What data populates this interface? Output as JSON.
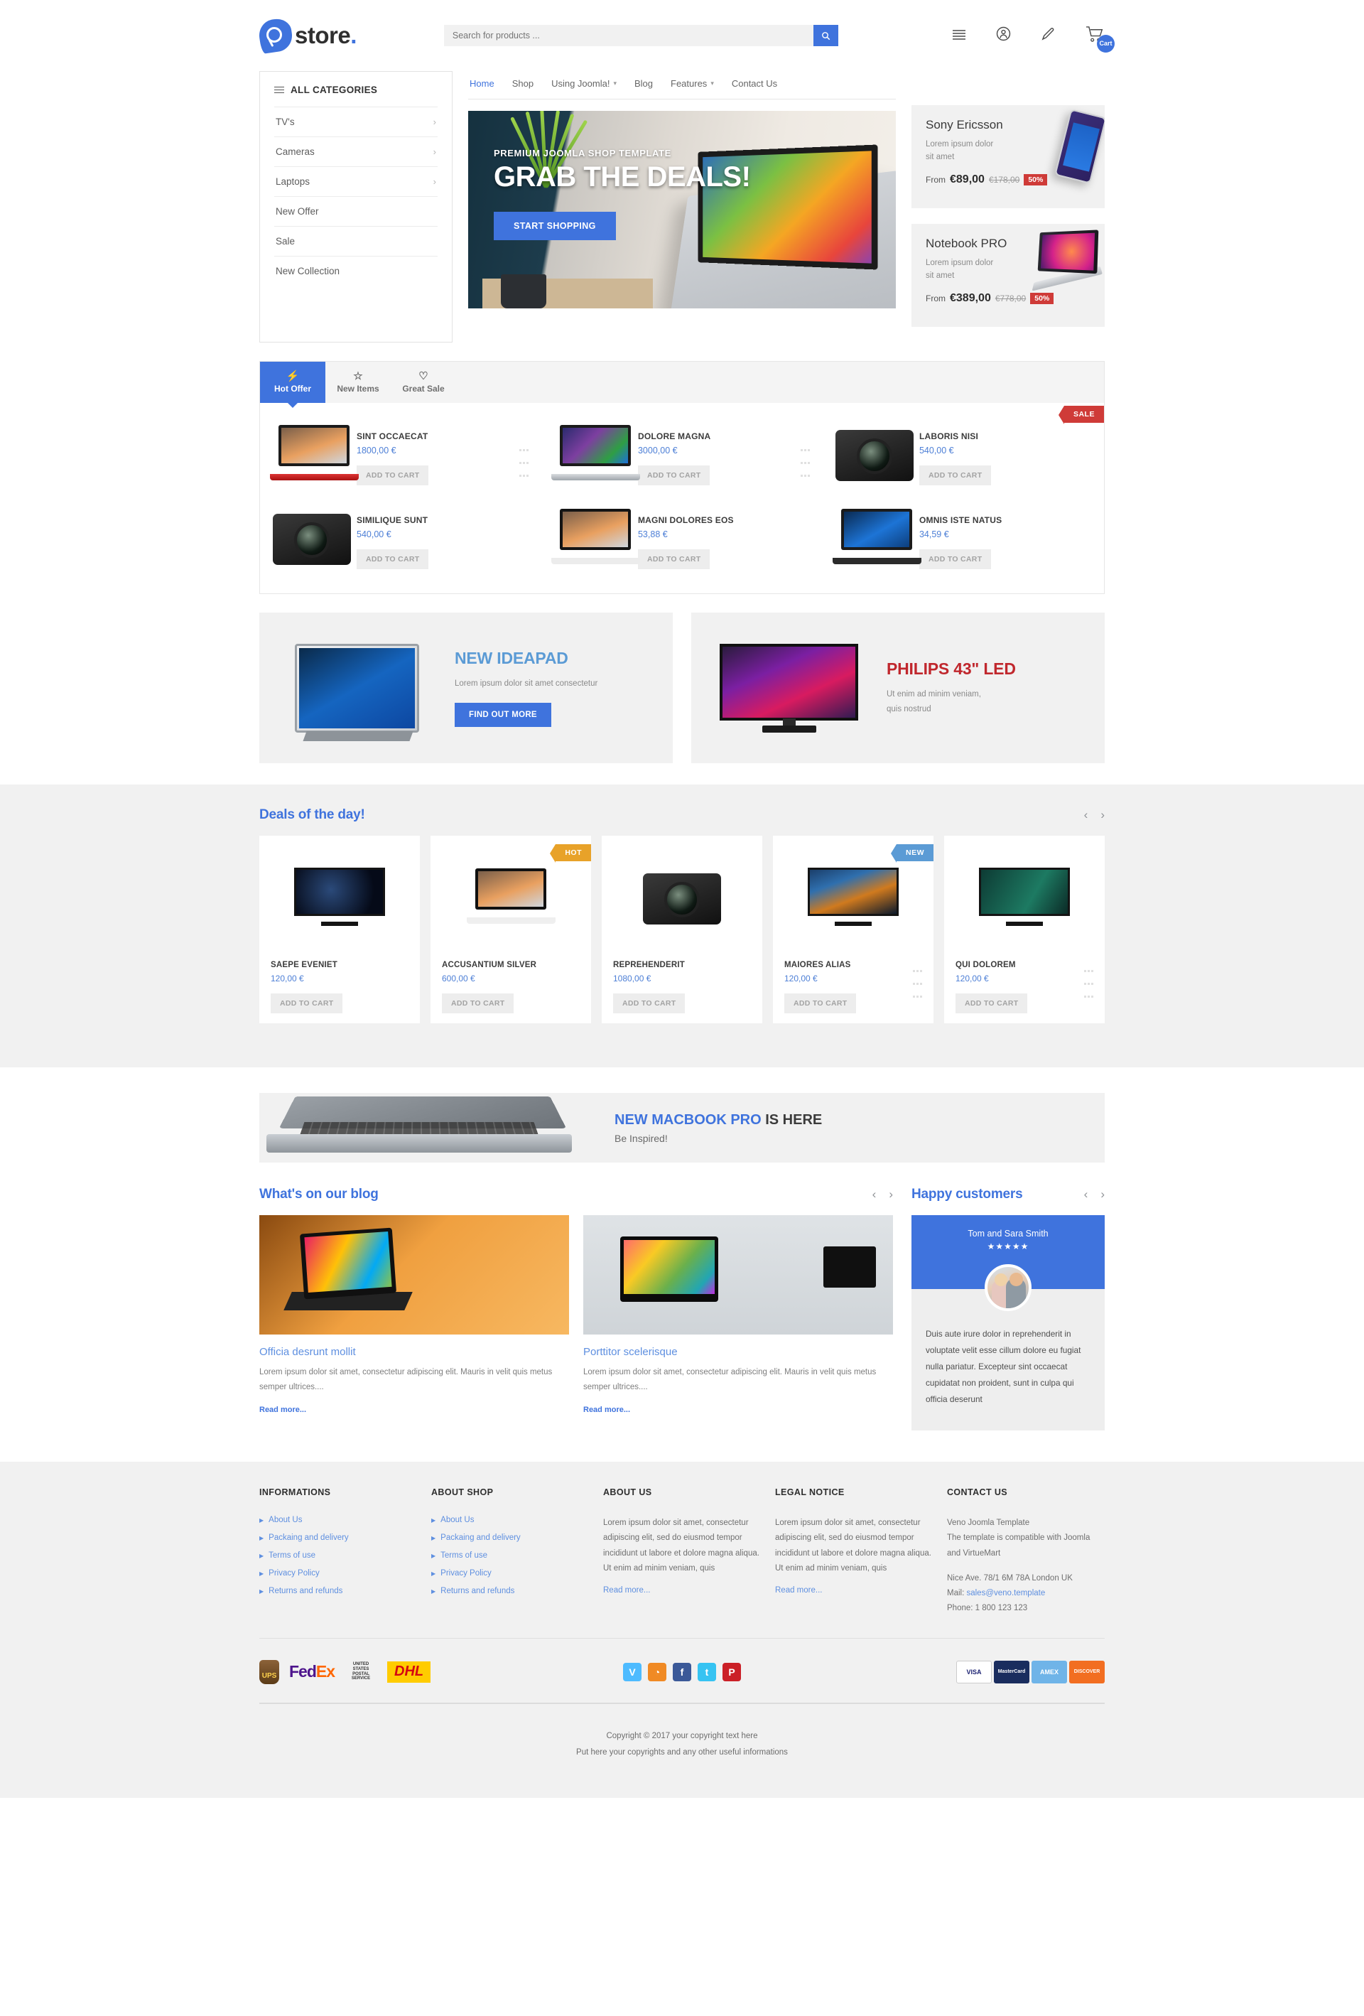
{
  "header": {
    "logo_text": "store.",
    "logo_dot": ".",
    "search_placeholder": "Search for products ...",
    "search_value": "",
    "search_icon": "search-icon",
    "icons": [
      {
        "name": "menu-icon",
        "label": "Menu"
      },
      {
        "name": "user-account-icon",
        "label": "Account"
      },
      {
        "name": "edit-pencil-icon",
        "label": "Edit"
      },
      {
        "name": "shopping-cart-icon",
        "label": "Cart"
      }
    ],
    "cart_badge": "Cart"
  },
  "categories": {
    "title": "ALL CATEGORIES",
    "items": [
      {
        "label": "TV's",
        "has_children": true
      },
      {
        "label": "Cameras",
        "has_children": true
      },
      {
        "label": "Laptops",
        "has_children": true
      },
      {
        "label": "New Offer",
        "has_children": false
      },
      {
        "label": "Sale",
        "has_children": false
      },
      {
        "label": "New Collection",
        "has_children": false
      }
    ]
  },
  "nav": [
    {
      "label": "Home",
      "active": true,
      "caret": false
    },
    {
      "label": "Shop",
      "active": false,
      "caret": false
    },
    {
      "label": "Using Joomla!",
      "active": false,
      "caret": true
    },
    {
      "label": "Blog",
      "active": false,
      "caret": false
    },
    {
      "label": "Features",
      "active": false,
      "caret": true
    },
    {
      "label": "Contact Us",
      "active": false,
      "caret": false
    }
  ],
  "hero": {
    "kicker": "PREMIUM JOOMLA SHOP TEMPLATE",
    "title": "GRAB THE DEALS!",
    "button": "START SHOPPING"
  },
  "promos": [
    {
      "title": "Sony Ericsson",
      "desc_line1": "Lorem ipsum dolor",
      "desc_line2": "sit amet",
      "from_label": "From",
      "price": "€89,00",
      "old_price": "€178,00",
      "discount": "50%"
    },
    {
      "title": "Notebook PRO",
      "desc_line1": "Lorem ipsum dolor",
      "desc_line2": "sit amet",
      "from_label": "From",
      "price": "€389,00",
      "old_price": "€778,00",
      "discount": "50%"
    }
  ],
  "tabs": [
    {
      "label": "Hot Offer",
      "icon": "bolt-icon",
      "glyph": "⚡",
      "active": true
    },
    {
      "label": "New Items",
      "icon": "star-icon",
      "glyph": "☆",
      "active": false
    },
    {
      "label": "Great Sale",
      "icon": "heart-icon",
      "glyph": "♡",
      "active": false
    }
  ],
  "products": [
    {
      "name": "SINT OCCAECAT",
      "price": "1800,00 €",
      "cart": "ADD TO CART",
      "art": "laptop-red",
      "ribbon": null
    },
    {
      "name": "DOLORE MAGNA",
      "price": "3000,00 €",
      "cart": "ADD TO CART",
      "art": "laptop-win8",
      "ribbon": null
    },
    {
      "name": "LABORIS NISI",
      "price": "540,00 €",
      "cart": "ADD TO CART",
      "art": "dslr",
      "ribbon": "SALE"
    },
    {
      "name": "SIMILIQUE SUNT",
      "price": "540,00 €",
      "cart": "ADD TO CART",
      "art": "camera",
      "ribbon": null
    },
    {
      "name": "MAGNI DOLORES EOS",
      "price": "53,88 €",
      "cart": "ADD TO CART",
      "art": "tablet-conv",
      "ribbon": null
    },
    {
      "name": "OMNIS ISTE NATUS",
      "price": "34,59 €",
      "cart": "ADD TO CART",
      "art": "laptop-black",
      "ribbon": null
    }
  ],
  "banners": [
    {
      "title": "NEW IDEAPAD",
      "text": "Lorem ipsum dolor sit amet consectetur",
      "button": "FIND OUT MORE",
      "color": "#5b9bd5"
    },
    {
      "title": "PHILIPS 43\" LED",
      "text_line1": "Ut enim ad minim veniam,",
      "text_line2": "quis nostrud",
      "color": "#c0272d"
    }
  ],
  "deals": {
    "title": "Deals of the day!",
    "prev": "‹",
    "next": "›",
    "items": [
      {
        "name": "SAEPE EVENIET",
        "price": "120,00 €",
        "cart": "ADD TO CART",
        "ribbon": null,
        "art": "tv-space"
      },
      {
        "name": "ACCUSANTIUM SILVER",
        "price": "600,00 €",
        "cart": "ADD TO CART",
        "ribbon": "HOT",
        "ribbon_kind": "hot",
        "art": "tablet-conv"
      },
      {
        "name": "REPREHENDERIT",
        "price": "1080,00 €",
        "cart": "ADD TO CART",
        "ribbon": null,
        "art": "camera"
      },
      {
        "name": "MAIORES ALIAS",
        "price": "120,00 €",
        "cart": "ADD TO CART",
        "ribbon": "NEW",
        "ribbon_kind": "new",
        "art": "tv-bridge"
      },
      {
        "name": "QUI DOLOREM",
        "price": "120,00 €",
        "cart": "ADD TO CART",
        "ribbon": null,
        "art": "tv-smart"
      }
    ]
  },
  "macbook_banner": {
    "highlight": "NEW MACBOOK PRO",
    "rest": " IS HERE",
    "sub": "Be Inspired!"
  },
  "blog": {
    "title": "What's on our blog",
    "prev": "‹",
    "next": "›",
    "posts": [
      {
        "title": "Officia desrunt mollit",
        "excerpt": "Lorem ipsum dolor sit amet, consectetur adipiscing elit. Mauris in velit quis metus semper ultrices....",
        "read_more": "Read more..."
      },
      {
        "title": "Porttitor scelerisque",
        "excerpt": "Lorem ipsum dolor sit amet, consectetur adipiscing elit. Mauris in velit quis metus semper ultrices....",
        "read_more": "Read more..."
      }
    ]
  },
  "testimonials": {
    "title": "Happy customers",
    "prev": "‹",
    "next": "›",
    "name": "Tom and Sara Smith",
    "stars": "★★★★★",
    "text": "Duis aute irure dolor in reprehenderit in voluptate velit esse cillum dolore eu fugiat nulla pariatur. Excepteur sint occaecat cupidatat non proident, sunt in culpa qui officia deserunt"
  },
  "footer": {
    "col1": {
      "title": "INFORMATIONS",
      "links": [
        "About Us",
        "Packaing and delivery",
        "Terms of use",
        "Privacy Policy",
        "Returns and refunds"
      ]
    },
    "col2": {
      "title": "ABOUT SHOP",
      "links": [
        "About Us",
        "Packaing and delivery",
        "Terms of use",
        "Privacy Policy",
        "Returns and refunds"
      ]
    },
    "col3": {
      "title": "ABOUT US",
      "text": "Lorem ipsum dolor sit amet, consectetur adipiscing elit, sed do eiusmod tempor incididunt ut labore et dolore magna aliqua. Ut enim ad minim veniam, quis",
      "read_more": "Read more..."
    },
    "col4": {
      "title": "LEGAL NOTICE",
      "text": "Lorem ipsum dolor sit amet, consectetur adipiscing elit, sed do eiusmod tempor incididunt ut labore et dolore magna aliqua. Ut enim ad minim veniam, quis",
      "read_more": "Read more..."
    },
    "col5": {
      "title": "CONTACT US",
      "line1": "Veno Joomla Template",
      "line2": "The template is compatible with Joomla and VirtueMart",
      "address": "Nice Ave. 78/1 6M 78A London UK",
      "mail_label": "Mail:",
      "mail": "sales@veno.template",
      "phone": "Phone: 1 800 123 123"
    },
    "shipping_logos": [
      "UPS",
      "FedEx",
      "USPS",
      "DHL"
    ],
    "social": [
      {
        "name": "vimeo-icon",
        "glyph": "V",
        "color": "#4ebbff"
      },
      {
        "name": "rss-icon",
        "glyph": "◔",
        "color": "#f08a24"
      },
      {
        "name": "facebook-icon",
        "glyph": "f",
        "color": "#3b5998"
      },
      {
        "name": "twitter-icon",
        "glyph": "t",
        "color": "#36c3f2"
      },
      {
        "name": "pinterest-icon",
        "glyph": "P",
        "color": "#cb2027"
      }
    ],
    "payments": [
      {
        "name": "VISA",
        "color": "#1a1f71",
        "bg": "#ffffff"
      },
      {
        "name": "MasterCard",
        "color": "#ffffff",
        "bg": "#1a2d5e"
      },
      {
        "name": "AMEX",
        "color": "#ffffff",
        "bg": "#6fb4e8"
      },
      {
        "name": "DISCOVER",
        "color": "#ffffff",
        "bg": "#f26e21"
      }
    ],
    "copyright_line1": "Copyright © 2017 your copyright text here",
    "copyright_line2": "Put here your copyrights and any other useful informations"
  },
  "colors": {
    "accent": "#3f73dd",
    "link": "#5e8fe0",
    "sale": "#cf3b38",
    "hot": "#e8a229",
    "new": "#5b9bd5"
  }
}
